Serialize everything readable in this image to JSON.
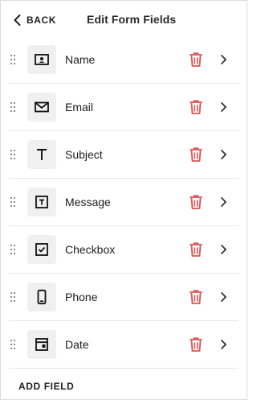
{
  "header": {
    "back_label": "BACK",
    "title": "Edit Form Fields"
  },
  "fields": [
    {
      "label": "Name",
      "icon": "name-card-icon"
    },
    {
      "label": "Email",
      "icon": "envelope-icon"
    },
    {
      "label": "Subject",
      "icon": "text-t-icon"
    },
    {
      "label": "Message",
      "icon": "text-box-icon"
    },
    {
      "label": "Checkbox",
      "icon": "checkbox-icon"
    },
    {
      "label": "Phone",
      "icon": "phone-icon"
    },
    {
      "label": "Date",
      "icon": "calendar-icon"
    }
  ],
  "footer": {
    "add_field_label": "ADD FIELD"
  },
  "colors": {
    "trash": "#e05252",
    "icon_bg": "#f0f0f0",
    "divider": "#e7e7e7"
  }
}
